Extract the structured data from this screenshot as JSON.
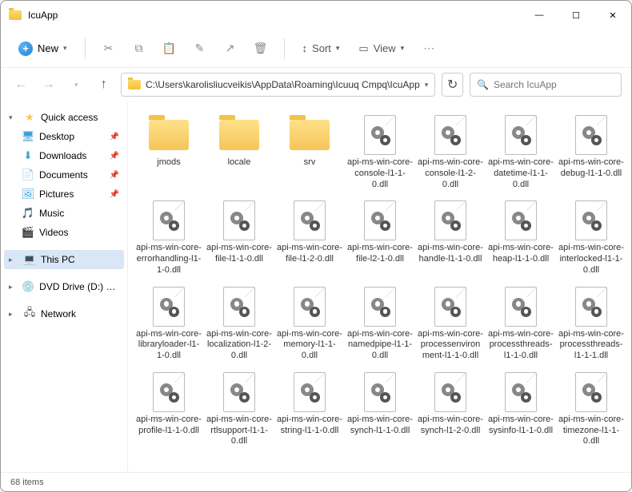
{
  "title": "IcuApp",
  "toolbar": {
    "new": "New",
    "sort": "Sort",
    "view": "View"
  },
  "address": {
    "path": "C:\\Users\\karolisliucveikis\\AppData\\Roaming\\Icuuq Cmpq\\IcuApp"
  },
  "search": {
    "placeholder": "Search IcuApp"
  },
  "sidebar": {
    "quick": "Quick access",
    "items": [
      {
        "label": "Desktop"
      },
      {
        "label": "Downloads"
      },
      {
        "label": "Documents"
      },
      {
        "label": "Pictures"
      },
      {
        "label": "Music"
      },
      {
        "label": "Videos"
      }
    ],
    "thispc": "This PC",
    "dvd": "DVD Drive (D:) CCCC",
    "network": "Network"
  },
  "files": [
    {
      "name": "jmods",
      "type": "folder"
    },
    {
      "name": "locale",
      "type": "folder"
    },
    {
      "name": "srv",
      "type": "folder"
    },
    {
      "name": "api-ms-win-core-console-l1-1-0.dll",
      "type": "dll"
    },
    {
      "name": "api-ms-win-core-console-l1-2-0.dll",
      "type": "dll"
    },
    {
      "name": "api-ms-win-core-datetime-l1-1-0.dll",
      "type": "dll"
    },
    {
      "name": "api-ms-win-core-debug-l1-1-0.dll",
      "type": "dll"
    },
    {
      "name": "api-ms-win-core-errorhandling-l1-1-0.dll",
      "type": "dll"
    },
    {
      "name": "api-ms-win-core-file-l1-1-0.dll",
      "type": "dll"
    },
    {
      "name": "api-ms-win-core-file-l1-2-0.dll",
      "type": "dll"
    },
    {
      "name": "api-ms-win-core-file-l2-1-0.dll",
      "type": "dll"
    },
    {
      "name": "api-ms-win-core-handle-l1-1-0.dll",
      "type": "dll"
    },
    {
      "name": "api-ms-win-core-heap-l1-1-0.dll",
      "type": "dll"
    },
    {
      "name": "api-ms-win-core-interlocked-l1-1-0.dll",
      "type": "dll"
    },
    {
      "name": "api-ms-win-core-libraryloader-l1-1-0.dll",
      "type": "dll"
    },
    {
      "name": "api-ms-win-core-localization-l1-2-0.dll",
      "type": "dll"
    },
    {
      "name": "api-ms-win-core-memory-l1-1-0.dll",
      "type": "dll"
    },
    {
      "name": "api-ms-win-core-namedpipe-l1-1-0.dll",
      "type": "dll"
    },
    {
      "name": "api-ms-win-core-processenvironment-l1-1-0.dll",
      "type": "dll"
    },
    {
      "name": "api-ms-win-core-processthreads-l1-1-0.dll",
      "type": "dll"
    },
    {
      "name": "api-ms-win-core-processthreads-l1-1-1.dll",
      "type": "dll"
    },
    {
      "name": "api-ms-win-core-profile-l1-1-0.dll",
      "type": "dll"
    },
    {
      "name": "api-ms-win-core-rtlsupport-l1-1-0.dll",
      "type": "dll"
    },
    {
      "name": "api-ms-win-core-string-l1-1-0.dll",
      "type": "dll"
    },
    {
      "name": "api-ms-win-core-synch-l1-1-0.dll",
      "type": "dll"
    },
    {
      "name": "api-ms-win-core-synch-l1-2-0.dll",
      "type": "dll"
    },
    {
      "name": "api-ms-win-core-sysinfo-l1-1-0.dll",
      "type": "dll"
    },
    {
      "name": "api-ms-win-core-timezone-l1-1-0.dll",
      "type": "dll"
    }
  ],
  "status": {
    "count": "68 items"
  }
}
